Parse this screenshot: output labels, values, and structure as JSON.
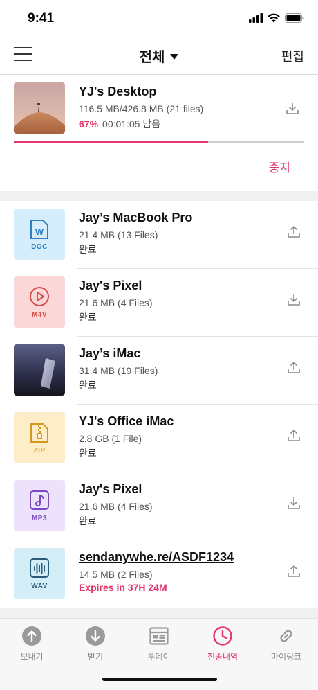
{
  "status_bar": {
    "time": "9:41"
  },
  "nav": {
    "title": "전체",
    "edit_label": "편집"
  },
  "active_transfer": {
    "name": "YJ's Desktop",
    "size": "116.5 MB/426.8 MB (21 files)",
    "percent": "67%",
    "remaining": "00:01:05 남음",
    "progress": 0.67,
    "stop_label": "중지",
    "direction": "download"
  },
  "transfers": [
    {
      "name": "Jay’s MacBook Pro",
      "size": "21.4 MB (13 Files)",
      "status": "완료",
      "thumb": "doc-file-icon",
      "ext": "DOC",
      "direction": "upload"
    },
    {
      "name": "Jay's Pixel",
      "size": "21.6 MB (4 Files)",
      "status": "완료",
      "thumb": "video-file-icon",
      "ext": "M4V",
      "direction": "download"
    },
    {
      "name": "Jay’s iMac",
      "size": "31.4 MB (19 Files)",
      "status": "완료",
      "thumb": "photo-thumbnail",
      "ext": "",
      "direction": "upload"
    },
    {
      "name": "YJ's Office iMac",
      "size": "2.8 GB (1 File)",
      "status": "완료",
      "thumb": "zip-file-icon",
      "ext": "ZIP",
      "direction": "upload"
    },
    {
      "name": "Jay's Pixel",
      "size": "21.6 MB (4 Files)",
      "status": "완료",
      "thumb": "music-file-icon",
      "ext": "MP3",
      "direction": "download"
    },
    {
      "name": "sendanywhe.re/ASDF1234",
      "size": "14.5 MB (2 Files)",
      "status": "Expires in 37H 24M",
      "thumb": "audio-wave-icon",
      "ext": "WAV",
      "direction": "upload"
    }
  ],
  "tabs": [
    {
      "label": "보내기",
      "icon": "send-icon"
    },
    {
      "label": "받기",
      "icon": "receive-icon"
    },
    {
      "label": "투데이",
      "icon": "today-icon"
    },
    {
      "label": "전송내역",
      "icon": "history-icon",
      "active": true
    },
    {
      "label": "마이링크",
      "icon": "link-icon"
    }
  ],
  "colors": {
    "accent": "#e5366b",
    "divider": "#f0f0f0"
  }
}
